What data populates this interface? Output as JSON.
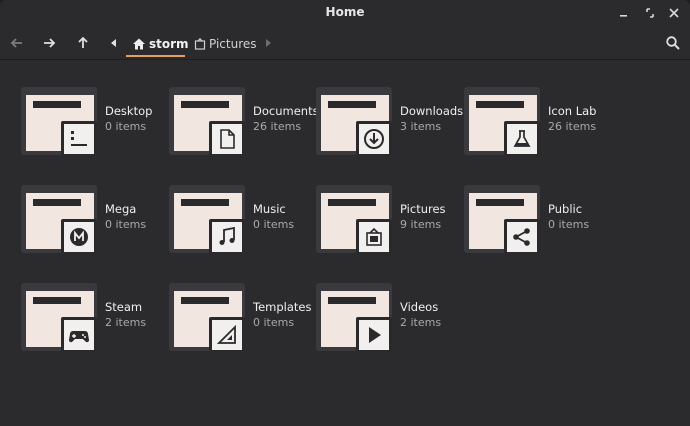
{
  "window": {
    "title": "Home"
  },
  "toolbar": {
    "breadcrumbs": [
      {
        "label": "storm",
        "active": true
      },
      {
        "label": "Pictures",
        "active": false
      }
    ]
  },
  "folders": [
    {
      "name": "Desktop",
      "count": "0 items",
      "emblem": "desktop-icon"
    },
    {
      "name": "Documents",
      "count": "26 items",
      "emblem": "document-icon"
    },
    {
      "name": "Downloads",
      "count": "3 items",
      "emblem": "download-icon"
    },
    {
      "name": "Icon Lab",
      "count": "26 items",
      "emblem": "flask-icon"
    },
    {
      "name": "Mega",
      "count": "0 items",
      "emblem": "mega-icon"
    },
    {
      "name": "Music",
      "count": "0 items",
      "emblem": "music-note-icon"
    },
    {
      "name": "Pictures",
      "count": "9 items",
      "emblem": "picture-icon"
    },
    {
      "name": "Public",
      "count": "0 items",
      "emblem": "share-icon"
    },
    {
      "name": "Steam",
      "count": "2 items",
      "emblem": "gamepad-icon"
    },
    {
      "name": "Templates",
      "count": "0 items",
      "emblem": "template-icon"
    },
    {
      "name": "Videos",
      "count": "2 items",
      "emblem": "play-icon"
    }
  ],
  "colors": {
    "background": "#2b2b2d",
    "folder_back": "#3a3a3e",
    "folder_front": "#f0e6df",
    "accent": "#e0a060"
  }
}
